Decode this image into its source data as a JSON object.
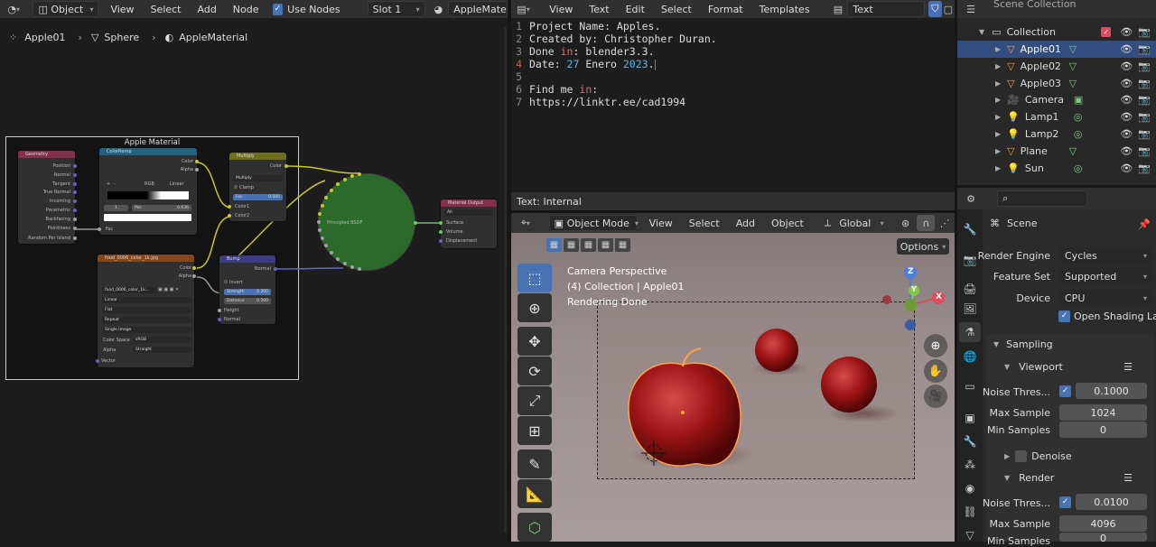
{
  "node_editor": {
    "header": {
      "mode": "Object",
      "menus": [
        "View",
        "Select",
        "Add",
        "Node"
      ],
      "use_nodes_label": "Use Nodes",
      "slot": "Slot 1",
      "material": "AppleMateria"
    },
    "breadcrumb": [
      "Apple01",
      "Sphere",
      "AppleMaterial"
    ],
    "frame_label": "Apple Material",
    "nodes": {
      "geometry": {
        "title": "Geometry",
        "outputs": [
          "Position",
          "Normal",
          "Tangent",
          "True Normal",
          "Incoming",
          "Parametric",
          "Backfacing",
          "Pointiness",
          "Random Per Island"
        ]
      },
      "colorramp": {
        "title": "ColorRamp",
        "outputs": [
          "Color",
          "Alpha"
        ],
        "mode": "RGB",
        "interp": "Linear",
        "index": "1",
        "pos_label": "Pos",
        "pos_value": "0.636",
        "fac": "Fac"
      },
      "multiply": {
        "title": "Multiply",
        "out": "Color",
        "blend": "Multiply",
        "clamp": "Clamp",
        "fac_label": "Fac",
        "fac_value": "0.500",
        "in1": "Color1",
        "in2": "Color2"
      },
      "image": {
        "title": "food_0006_color_1k.jpg",
        "outputs": [
          "Color",
          "Alpha"
        ],
        "file": "food_0006_color_1k...",
        "interp": "Linear",
        "proj": "Flat",
        "ext": "Repeat",
        "src": "Single Image",
        "cs_label": "Color Space",
        "cs": "sRGB",
        "alpha_label": "Alpha",
        "alpha": "Straight",
        "vector": "Vector"
      },
      "bump": {
        "title": "Bump",
        "out": "Normal",
        "invert": "Invert",
        "strength_label": "Strength",
        "strength": "0.300",
        "distance_label": "Distance",
        "distance": "0.500",
        "height": "Height",
        "normal": "Normal"
      },
      "bsdf": {
        "label": "Principled BSDF"
      },
      "output": {
        "title": "Material Output",
        "target": "All",
        "inputs": [
          "Surface",
          "Volume",
          "Displacement"
        ]
      }
    }
  },
  "text_editor": {
    "header": {
      "menus": [
        "View",
        "Text",
        "Edit",
        "Select",
        "Format",
        "Templates"
      ],
      "file": "Text"
    },
    "lines": [
      {
        "n": "1",
        "text": "Project Name: Apples."
      },
      {
        "n": "2",
        "text": "Created by: Christopher Duran."
      },
      {
        "n": "3",
        "a": "Done ",
        "kw": "in",
        "b": ": blender3.3."
      },
      {
        "n": "4",
        "a": "Date: ",
        "num": "27",
        "b": " Enero ",
        "num2": "2023",
        "c": "."
      },
      {
        "n": "5",
        "text": ""
      },
      {
        "n": "6",
        "a": "Find me ",
        "kw": "in",
        "b": ":"
      },
      {
        "n": "7",
        "text": "https://linktr.ee/cad1994"
      }
    ],
    "footer": "Text: Internal"
  },
  "viewport": {
    "header": {
      "mode": "Object Mode",
      "menus": [
        "View",
        "Select",
        "Add",
        "Object"
      ],
      "orientation": "Global",
      "options": "Options"
    },
    "overlay": [
      "Camera Perspective",
      "(4) Collection | Apple01",
      "Rendering Done"
    ],
    "gizmo": {
      "x": "X",
      "y": "Y",
      "z": "Z"
    }
  },
  "outliner": {
    "top_partial": "Scene Collection",
    "collection": "Collection",
    "items": [
      "Apple01",
      "Apple02",
      "Apple03",
      "Camera",
      "Lamp1",
      "Lamp2",
      "Plane",
      "Sun"
    ]
  },
  "properties": {
    "scene": "Scene",
    "render_engine_label": "Render Engine",
    "render_engine": "Cycles",
    "feature_set_label": "Feature Set",
    "feature_set": "Supported",
    "device_label": "Device",
    "device": "CPU",
    "osl_label": "Open Shading La...",
    "sampling": "Sampling",
    "viewport": "Viewport",
    "noise_label": "Noise Thres...",
    "vp_noise": "0.1000",
    "max_label": "Max Sample",
    "vp_max": "1024",
    "min_label": "Min Samples",
    "vp_min": "0",
    "denoise": "Denoise",
    "render": "Render",
    "r_noise": "0.0100",
    "r_max": "4096",
    "r_min_label": "Min Samples",
    "r_min": "0"
  },
  "colors": {
    "accent": "#4772b3",
    "bsdf": "#2c6a2c",
    "selection": "#ffa046"
  }
}
